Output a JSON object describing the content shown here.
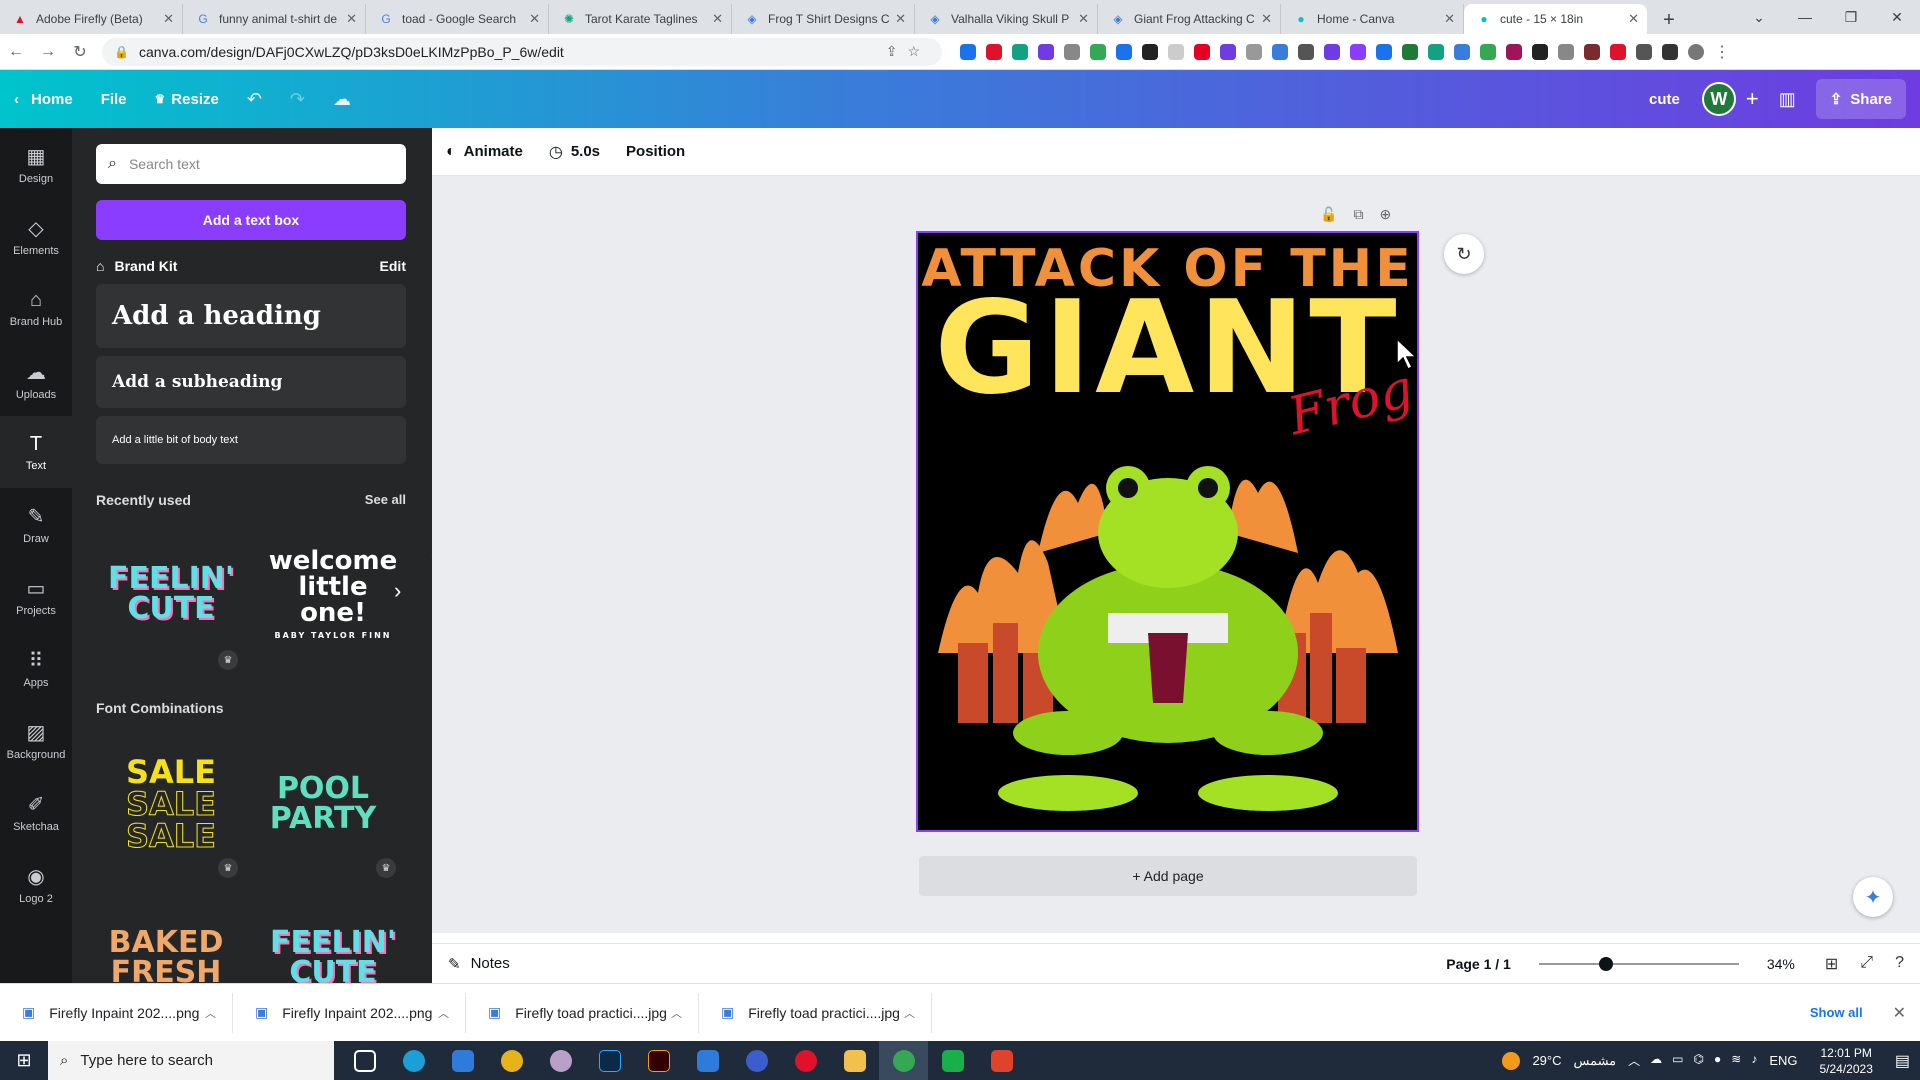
{
  "browser": {
    "tabs": [
      {
        "title": "Adobe Firefly (Beta)",
        "color": "#e0112b"
      },
      {
        "title": "funny animal t-shirt de",
        "color": "#4285f4"
      },
      {
        "title": "toad - Google Search",
        "color": "#4285f4"
      },
      {
        "title": "Tarot Karate Taglines",
        "color": "#10a37f"
      },
      {
        "title": "Frog T Shirt Designs C",
        "color": "#3a7cd9"
      },
      {
        "title": "Valhalla Viking Skull P",
        "color": "#3a7cd9"
      },
      {
        "title": "Giant Frog Attacking C",
        "color": "#3a7cd9"
      },
      {
        "title": "Home - Canva",
        "color": "#00c4cc"
      },
      {
        "title": "cute - 15 × 18in",
        "color": "#00c4cc"
      }
    ],
    "url": "canva.com/design/DAFj0CXwLZQ/pD3ksD0eLKIMzPpBo_P_6w/edit"
  },
  "header": {
    "home": "Home",
    "file": "File",
    "resize": "Resize",
    "doc_title": "cute",
    "avatar_letter": "W",
    "share": "Share"
  },
  "rail": {
    "items": [
      {
        "label": "Design",
        "icon": "▦"
      },
      {
        "label": "Elements",
        "icon": "◇"
      },
      {
        "label": "Brand Hub",
        "icon": "⌂"
      },
      {
        "label": "Uploads",
        "icon": "☁"
      },
      {
        "label": "Text",
        "icon": "T"
      },
      {
        "label": "Draw",
        "icon": "✎"
      },
      {
        "label": "Projects",
        "icon": "▭"
      },
      {
        "label": "Apps",
        "icon": "⠿"
      },
      {
        "label": "Background",
        "icon": "▨"
      },
      {
        "label": "Sketchaa",
        "icon": "✐"
      },
      {
        "label": "Logo 2",
        "icon": "◉"
      }
    ]
  },
  "panel": {
    "search_placeholder": "Search text",
    "add_text_box": "Add a text box",
    "brand_kit": "Brand Kit",
    "brand_kit_edit": "Edit",
    "heading": "Add a heading",
    "subheading": "Add a subheading",
    "body": "Add a little bit of body text",
    "recently_used": "Recently used",
    "see_all": "See all",
    "font_combinations": "Font Combinations",
    "thumbs": {
      "feelin_cute": "FEELIN' CUTE",
      "welcome": "welcome little one!",
      "welcome_sub": "BABY TAYLOR FINN",
      "sale": "SALE",
      "pool_party": "POOL PARTY",
      "baked_fresh": "BAKED FRESH",
      "feelin_cute2": "FEELIN' CUTE"
    }
  },
  "toolbar": {
    "animate": "Animate",
    "duration": "5.0s",
    "position": "Position"
  },
  "design": {
    "line1": "ATTACK OF THE",
    "line2": "GIANT",
    "line3": "Frog"
  },
  "canvas": {
    "add_page": "+ Add page"
  },
  "statusbar": {
    "notes": "Notes",
    "page": "Page 1 / 1",
    "zoom": "34%"
  },
  "downloads": {
    "items": [
      "Firefly Inpaint 202....png",
      "Firefly Inpaint 202....png",
      "Firefly toad practici....jpg",
      "Firefly toad practici....jpg"
    ],
    "show_all": "Show all"
  },
  "taskbar": {
    "search_placeholder": "Type here to search",
    "weather": "29°C",
    "weather_label": "مشمس",
    "lang": "ENG",
    "time": "12:01 PM",
    "date": "5/24/2023"
  }
}
